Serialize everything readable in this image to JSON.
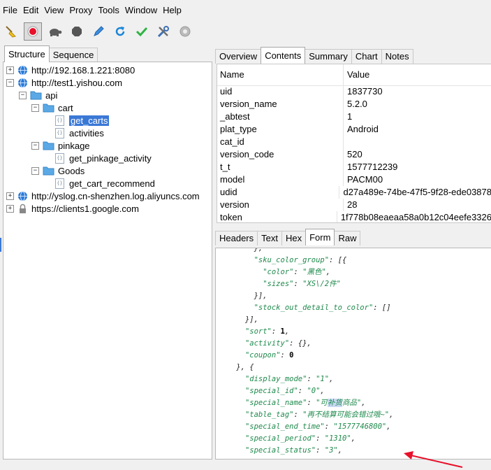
{
  "menubar": [
    "File",
    "Edit",
    "View",
    "Proxy",
    "Tools",
    "Window",
    "Help"
  ],
  "toolbar": {
    "icons": [
      "broom-icon",
      "record-icon",
      "turtle-icon",
      "stop-icon",
      "pen-icon",
      "refresh-icon",
      "check-icon",
      "tools-icon",
      "settings-icon"
    ],
    "record_color": "#e8102a"
  },
  "left_tabs": [
    "Structure",
    "Sequence"
  ],
  "tree": [
    {
      "label": "http://192.168.1.221:8080",
      "kind": "globe",
      "exp": "+"
    },
    {
      "label": "http://test1.yishou.com",
      "kind": "globe",
      "exp": "−"
    },
    {
      "label": "api",
      "kind": "folder",
      "exp": "−"
    },
    {
      "label": "cart",
      "kind": "folder",
      "exp": "−"
    },
    {
      "label": "get_carts",
      "kind": "file",
      "selected": true
    },
    {
      "label": "activities",
      "kind": "file"
    },
    {
      "label": "pinkage",
      "kind": "folder",
      "exp": "−"
    },
    {
      "label": "get_pinkage_activity",
      "kind": "file"
    },
    {
      "label": "Goods",
      "kind": "folder",
      "exp": "−"
    },
    {
      "label": "get_cart_recommend",
      "kind": "file"
    },
    {
      "label": "http://yslog.cn-shenzhen.log.aliyuncs.com",
      "kind": "globe",
      "exp": "+"
    },
    {
      "label": "https://clients1.google.com",
      "kind": "lock",
      "exp": "+"
    }
  ],
  "top_tabs": [
    "Overview",
    "Contents",
    "Summary",
    "Chart",
    "Notes"
  ],
  "table": {
    "headers": {
      "name": "Name",
      "value": "Value"
    },
    "rows": [
      {
        "name": "uid",
        "value": "1837730"
      },
      {
        "name": "version_name",
        "value": "5.2.0"
      },
      {
        "name": "_abtest",
        "value": "1"
      },
      {
        "name": "plat_type",
        "value": "Android"
      },
      {
        "name": "cat_id",
        "value": ""
      },
      {
        "name": "version_code",
        "value": "520"
      },
      {
        "name": "t_t",
        "value": "1577712239"
      },
      {
        "name": "model",
        "value": "PACM00"
      },
      {
        "name": "udid",
        "value": "d27a489e-74be-47f5-9f28-ede03878"
      },
      {
        "name": "version",
        "value": "28"
      },
      {
        "name": "token",
        "value": "1f778b08eaeaa58a0b12c04eefe3326"
      }
    ]
  },
  "bottom_tabs": [
    "Headers",
    "Text",
    "Hex",
    "Form",
    "Raw"
  ],
  "code_lines": [
    {
      "indent": "        ",
      "parts": [
        [
          "p",
          "},"
        ]
      ]
    },
    {
      "indent": "        ",
      "parts": [
        [
          "s",
          "\"sku_color_group\""
        ],
        [
          "p",
          ": [{"
        ]
      ]
    },
    {
      "indent": "          ",
      "parts": [
        [
          "s",
          "\"color\""
        ],
        [
          "p",
          ": "
        ],
        [
          "s",
          "\"黑色\""
        ],
        [
          "p",
          ","
        ]
      ]
    },
    {
      "indent": "          ",
      "parts": [
        [
          "s",
          "\"sizes\""
        ],
        [
          "p",
          ": "
        ],
        [
          "s",
          "\"XS\\/2件\""
        ]
      ]
    },
    {
      "indent": "        ",
      "parts": [
        [
          "p",
          "}],"
        ]
      ]
    },
    {
      "indent": "        ",
      "parts": [
        [
          "s",
          "\"stock_out_detail_to_color\""
        ],
        [
          "p",
          ": []"
        ]
      ]
    },
    {
      "indent": "      ",
      "parts": [
        [
          "p",
          "}],"
        ]
      ]
    },
    {
      "indent": "      ",
      "parts": [
        [
          "s",
          "\"sort\""
        ],
        [
          "p",
          ": "
        ],
        [
          "n",
          "1"
        ],
        [
          "p",
          ","
        ]
      ]
    },
    {
      "indent": "      ",
      "parts": [
        [
          "s",
          "\"activity\""
        ],
        [
          "p",
          ": {},"
        ]
      ]
    },
    {
      "indent": "      ",
      "parts": [
        [
          "s",
          "\"coupon\""
        ],
        [
          "p",
          ": "
        ],
        [
          "n",
          "0"
        ]
      ]
    },
    {
      "indent": "    ",
      "parts": [
        [
          "p",
          "}, {"
        ]
      ]
    },
    {
      "indent": "      ",
      "parts": [
        [
          "s",
          "\"display_mode\""
        ],
        [
          "p",
          ": "
        ],
        [
          "s",
          "\"1\""
        ],
        [
          "p",
          ","
        ]
      ]
    },
    {
      "indent": "      ",
      "parts": [
        [
          "s",
          "\"special_id\""
        ],
        [
          "p",
          ": "
        ],
        [
          "s",
          "\"0\""
        ],
        [
          "p",
          ","
        ]
      ]
    },
    {
      "indent": "      ",
      "parts": [
        [
          "s",
          "\"special_name\""
        ],
        [
          "p",
          ": "
        ],
        [
          "s",
          "\"可"
        ],
        [
          "h",
          "补货"
        ],
        [
          "s",
          "商品\""
        ],
        [
          "p",
          ","
        ]
      ]
    },
    {
      "indent": "      ",
      "parts": [
        [
          "s",
          "\"table_tag\""
        ],
        [
          "p",
          ": "
        ],
        [
          "s",
          "\"再不结算可能会错过哦~\""
        ],
        [
          "p",
          ","
        ]
      ]
    },
    {
      "indent": "      ",
      "parts": [
        [
          "s",
          "\"special_end_time\""
        ],
        [
          "p",
          ": "
        ],
        [
          "s",
          "\"1577746800\""
        ],
        [
          "p",
          ","
        ]
      ]
    },
    {
      "indent": "      ",
      "parts": [
        [
          "s",
          "\"special_period\""
        ],
        [
          "p",
          ": "
        ],
        [
          "s",
          "\"1310\""
        ],
        [
          "p",
          ","
        ]
      ]
    },
    {
      "indent": "      ",
      "parts": [
        [
          "s",
          "\"special_status\""
        ],
        [
          "p",
          ": "
        ],
        [
          "s",
          "\"3\""
        ],
        [
          "p",
          ","
        ]
      ]
    }
  ],
  "colors": {
    "selection": "#3a78d6",
    "globe": "#2a7ad6",
    "folder": "#5aa9e6",
    "arrow": "#e8102a"
  }
}
